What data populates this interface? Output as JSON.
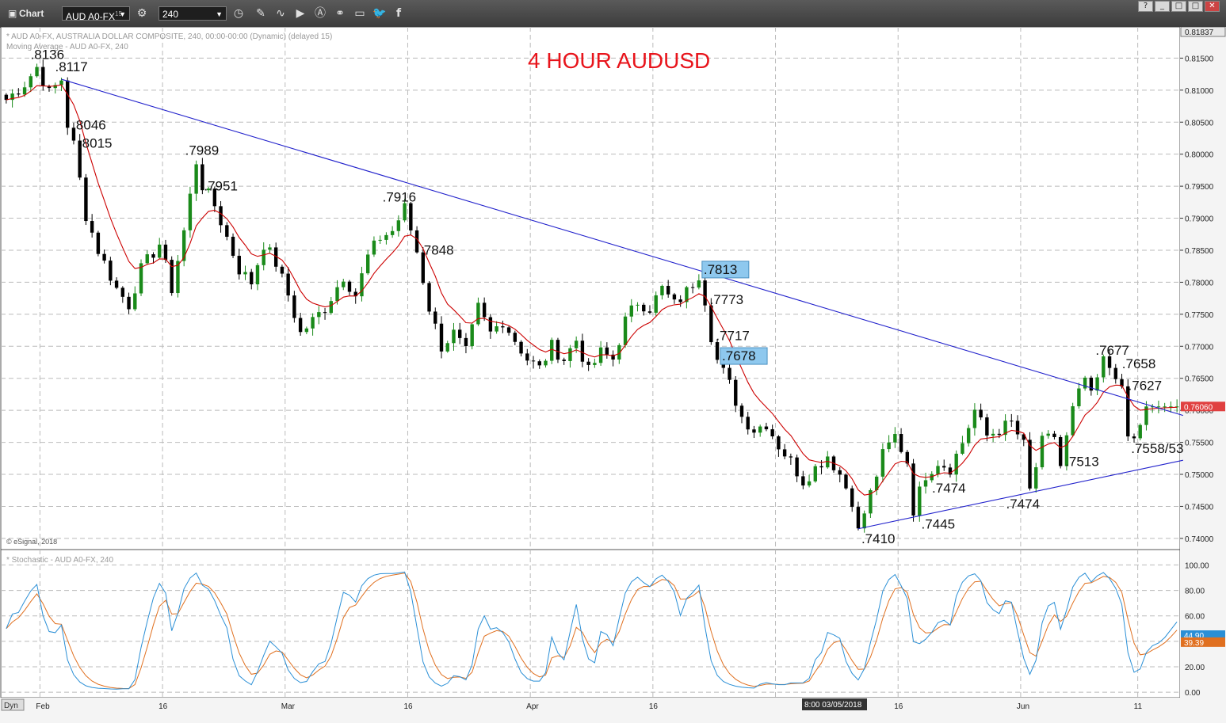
{
  "toolbar": {
    "window_title": "Chart",
    "symbol": "AUD A0-FX",
    "symbol_superscript": "15",
    "interval": "240",
    "icons": [
      "settings-icon",
      "clock-icon",
      "pencil-icon",
      "draw-curve-icon",
      "play-icon",
      "alert-icon",
      "link-icon",
      "message-icon",
      "twitter-icon",
      "facebook-icon"
    ],
    "window_buttons": [
      "?",
      "_",
      "□",
      "✕"
    ]
  },
  "header": {
    "description": "* AUD A0-FX, AUSTRALIA DOLLAR COMPOSITE, 240, 00:00-00:00 (Dynamic) (delayed 15)",
    "ma_line": "Moving Average - AUD A0-FX, 240",
    "big_title": "4 HOUR AUDUSD",
    "copyright": "© eSignal, 2018",
    "stoch_header": "* Stochastic - AUD A0-FX, 240",
    "dyn_label": "Dyn",
    "crosshair_time": "8:00 03/05/2018"
  },
  "colors": {
    "candle_up": "#1a8a1a",
    "candle_down": "#000000",
    "ma": "#cc0000",
    "trendline": "#2222cc",
    "stoch_k": "#2a8fd6",
    "stoch_d": "#e07020",
    "title_red": "#e8141b",
    "label_highlight": "#8ec8ee"
  },
  "chart_data": [
    {
      "type": "candlestick",
      "title": "4 HOUR AUDUSD",
      "x_ticks": [
        "Feb",
        "16",
        "Mar",
        "16",
        "Apr",
        "16",
        "",
        "16",
        "Jun",
        "11"
      ],
      "y_ticks": [
        "0.81500",
        "0.81000",
        "0.80500",
        "0.80000",
        "0.79500",
        "0.79000",
        "0.78500",
        "0.78000",
        "0.77500",
        "0.77000",
        "0.76500",
        "0.76000",
        "0.75500",
        "0.75000",
        "0.74500",
        "0.74000"
      ],
      "ylim": [
        0.7385,
        0.8195
      ],
      "top_tick_label": "0.81837",
      "last_price": "0.76060",
      "close_path": [
        [
          0,
          0.8085
        ],
        [
          3,
          0.811
        ],
        [
          5,
          0.8136
        ],
        [
          7,
          0.8095
        ],
        [
          9,
          0.8117
        ],
        [
          10,
          0.8046
        ],
        [
          11,
          0.8015
        ],
        [
          13,
          0.7905
        ],
        [
          15,
          0.785
        ],
        [
          18,
          0.779
        ],
        [
          20,
          0.7765
        ],
        [
          22,
          0.782
        ],
        [
          25,
          0.786
        ],
        [
          27,
          0.779
        ],
        [
          29,
          0.788
        ],
        [
          31,
          0.7989
        ],
        [
          32,
          0.7951
        ],
        [
          34,
          0.792
        ],
        [
          36,
          0.787
        ],
        [
          38,
          0.782
        ],
        [
          40,
          0.78
        ],
        [
          42,
          0.786
        ],
        [
          44,
          0.783
        ],
        [
          46,
          0.778
        ],
        [
          48,
          0.772
        ],
        [
          50,
          0.774
        ],
        [
          52,
          0.776
        ],
        [
          55,
          0.781
        ],
        [
          57,
          0.778
        ],
        [
          59,
          0.784
        ],
        [
          61,
          0.787
        ],
        [
          63,
          0.788
        ],
        [
          65,
          0.7916
        ],
        [
          67,
          0.7848
        ],
        [
          69,
          0.776
        ],
        [
          71,
          0.77
        ],
        [
          73,
          0.772
        ],
        [
          75,
          0.769
        ],
        [
          77,
          0.776
        ],
        [
          79,
          0.772
        ],
        [
          81,
          0.774
        ],
        [
          83,
          0.771
        ],
        [
          85,
          0.768
        ],
        [
          87,
          0.7665
        ],
        [
          89,
          0.77
        ],
        [
          91,
          0.768
        ],
        [
          93,
          0.771
        ],
        [
          95,
          0.766
        ],
        [
          97,
          0.769
        ],
        [
          99,
          0.768
        ],
        [
          101,
          0.774
        ],
        [
          103,
          0.777
        ],
        [
          105,
          0.776
        ],
        [
          107,
          0.779
        ],
        [
          109,
          0.7765
        ],
        [
          111,
          0.7785
        ],
        [
          113,
          0.7813
        ],
        [
          114,
          0.7773
        ],
        [
          115,
          0.7717
        ],
        [
          116,
          0.7678
        ],
        [
          118,
          0.764
        ],
        [
          120,
          0.759
        ],
        [
          122,
          0.757
        ],
        [
          124,
          0.758
        ],
        [
          126,
          0.7545
        ],
        [
          128,
          0.752
        ],
        [
          130,
          0.749
        ],
        [
          132,
          0.751
        ],
        [
          134,
          0.753
        ],
        [
          136,
          0.75
        ],
        [
          138,
          0.746
        ],
        [
          139,
          0.741
        ],
        [
          141,
          0.747
        ],
        [
          143,
          0.753
        ],
        [
          145,
          0.756
        ],
        [
          147,
          0.752
        ],
        [
          148,
          0.7445
        ],
        [
          150,
          0.75
        ],
        [
          152,
          0.752
        ],
        [
          154,
          0.751
        ],
        [
          156,
          0.755
        ],
        [
          158,
          0.76
        ],
        [
          160,
          0.756
        ],
        [
          162,
          0.757
        ],
        [
          164,
          0.758
        ],
        [
          166,
          0.7545
        ],
        [
          167,
          0.7474
        ],
        [
          169,
          0.755
        ],
        [
          171,
          0.756
        ],
        [
          172,
          0.7513
        ],
        [
          174,
          0.76
        ],
        [
          176,
          0.765
        ],
        [
          177,
          0.762
        ],
        [
          179,
          0.7677
        ],
        [
          181,
          0.7658
        ],
        [
          182,
          0.7627
        ],
        [
          183,
          0.7558
        ],
        [
          184,
          0.7553
        ],
        [
          186,
          0.7606
        ]
      ],
      "price_labels": [
        {
          "text": ".8136",
          "value": 0.8136,
          "i": 5
        },
        {
          "text": ".8117",
          "value": 0.8117,
          "i": 9
        },
        {
          "text": ".8046",
          "value": 0.8046,
          "i": 10
        },
        {
          "text": ".8015",
          "value": 0.8015,
          "i": 11
        },
        {
          "text": ".7989",
          "value": 0.7989,
          "i": 31
        },
        {
          "text": ".7951",
          "value": 0.7951,
          "i": 32
        },
        {
          "text": ".7916",
          "value": 0.7916,
          "i": 65
        },
        {
          "text": ".7848",
          "value": 0.7848,
          "i": 67
        },
        {
          "text": ".7813",
          "value": 0.7813,
          "i": 113,
          "highlight": true
        },
        {
          "text": ".7773",
          "value": 0.7773,
          "i": 114
        },
        {
          "text": ".7717",
          "value": 0.7717,
          "i": 115
        },
        {
          "text": ".7678",
          "value": 0.7678,
          "i": 116,
          "highlight": true
        },
        {
          "text": ".7410",
          "value": 0.741,
          "i": 139
        },
        {
          "text": ".7445",
          "value": 0.7445,
          "i": 148
        },
        {
          "text": ".7474",
          "value": 0.7474,
          "i": 150
        },
        {
          "text": ".7474",
          "value": 0.7474,
          "i": 167
        },
        {
          "text": ".7513",
          "value": 0.7513,
          "i": 172
        },
        {
          "text": ".7558/53",
          "value": 0.7553,
          "i": 183
        },
        {
          "text": ".7677",
          "value": 0.7677,
          "i": 179
        },
        {
          "text": ".7658",
          "value": 0.7658,
          "i": 181
        },
        {
          "text": ".7627",
          "value": 0.7627,
          "i": 182
        }
      ],
      "trendlines": [
        {
          "name": "down-trendline",
          "from": [
            9,
            0.8117
          ],
          "to": [
            192,
            0.7592
          ]
        },
        {
          "name": "up-trendline",
          "from": [
            139,
            0.7415
          ],
          "to": [
            192,
            0.7522
          ]
        }
      ]
    },
    {
      "type": "line",
      "title": "Stochastic - AUD A0-FX, 240",
      "y_ticks": [
        "100.00",
        "80.00",
        "60.00",
        "40.00",
        "20.00",
        "0.00"
      ],
      "ylim": [
        -3,
        104
      ],
      "last_k": "44.90",
      "last_d": "39.39",
      "series": [
        {
          "name": "%K",
          "color": "#2a8fd6"
        },
        {
          "name": "%D",
          "color": "#e07020"
        }
      ]
    }
  ]
}
